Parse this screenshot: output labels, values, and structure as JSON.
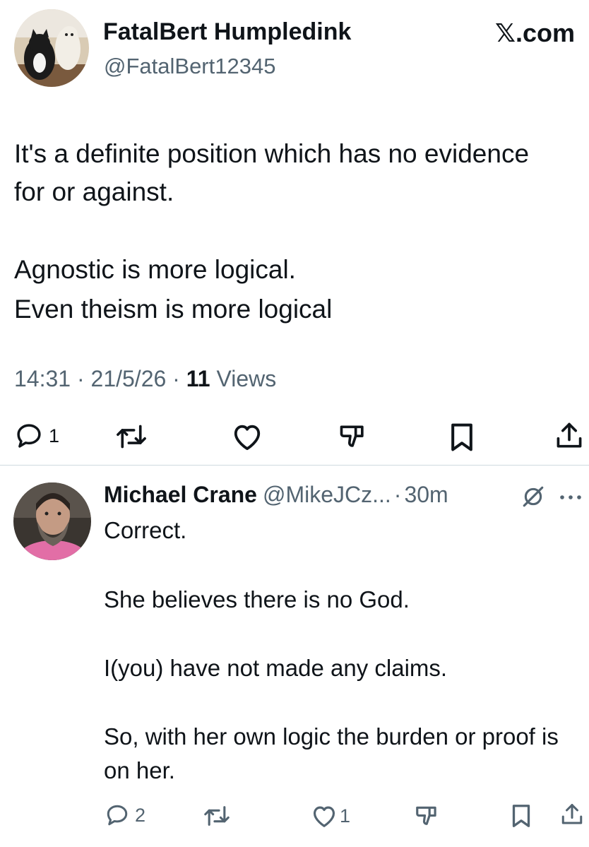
{
  "tweet": {
    "author": {
      "display_name": "FatalBert Humpledink",
      "handle": "@FatalBert12345"
    },
    "brand": "𝕏.com",
    "paragraphs": [
      "It's a definite position which has no evidence for or against.",
      "Agnostic is more logical.",
      "Even theism is more logical"
    ],
    "meta": {
      "time": "14:31",
      "sep1": " · ",
      "date": "21/5/26",
      "sep2": " · ",
      "views_count": "11",
      "views_label": " Views"
    },
    "actions": {
      "reply_count": "1"
    },
    "icons": [
      "reply-icon",
      "repost-icon",
      "like-icon",
      "dislike-icon",
      "bookmark-icon",
      "share-icon"
    ]
  },
  "reply": {
    "display_name": "Michael Crane",
    "handle": "@MikeJCz...",
    "separator": "·",
    "time": "30m",
    "paragraphs": [
      "Correct.",
      "She believes there is no God.",
      "I(you) have not made any claims.",
      "So, with her own logic the burden or proof is on her."
    ],
    "actions": {
      "reply_count": "2",
      "like_count": "1"
    },
    "icons": [
      "grok-icon",
      "more-icon",
      "reply-icon",
      "repost-icon",
      "like-icon",
      "dislike-icon",
      "bookmark-icon",
      "share-icon"
    ]
  },
  "colors": {
    "text": "#0f1419",
    "secondary": "#536471",
    "divider": "#cfd9de"
  }
}
